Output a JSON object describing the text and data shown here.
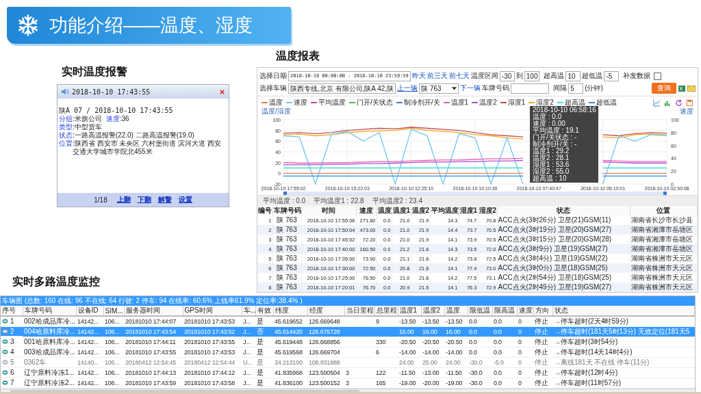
{
  "banner": {
    "title": "功能介绍——温度、湿度"
  },
  "alarm": {
    "heading": "实时温度报警",
    "time": "2018-10-10 17:43:55",
    "first_line": "陕A 07 / 2018-10-10 17:43:55",
    "lines": [
      [
        {
          "label": "分组",
          "value": ":米旗公司"
        },
        {
          "label": "速度",
          "value": ":36"
        }
      ],
      [
        {
          "label": "类型",
          "value": ":中型货车"
        }
      ],
      [
        {
          "label": "状态",
          "value": ":一路高温报警(22.0) 二路高温报警(19.0)"
        }
      ],
      [
        {
          "label": "位置",
          "value": ":陕西省 西安市 未央区 六村堡街道 滨河大道 西安交通大学城市学院北455米"
        }
      ]
    ],
    "page": "1/18",
    "links": [
      "上翻",
      "下翻",
      "解警",
      "设置"
    ]
  },
  "report": {
    "heading": "温度报表",
    "date_label": "选择日期",
    "date_value": "2018-10-10 00:00:00 - 2018-10-10 23:59:59",
    "quick_links": [
      "昨天",
      "前三天",
      "前七天"
    ],
    "range_label": "温度区间",
    "range_from": "-30",
    "range_to_label": "到",
    "range_to": "100",
    "high_label": "超高温",
    "high_value": "10",
    "low_label": "超低温",
    "low_value": "-5",
    "resend_label": "补发数据",
    "resend_checked": false,
    "vehicle_label": "选择车辆",
    "vehicle_value": "陕西专线,北京 有限公司,陕A 42,陕",
    "prev_link": "上一辆",
    "vehicle_select": "陕 763",
    "next_link": "下一辆",
    "plate_label": "车牌号码",
    "interval_label": "间隔",
    "interval_value": "5",
    "interval_unit": "(分钟)",
    "query_button": "查询",
    "legend": [
      {
        "label": "温度",
        "color": "#f08050"
      },
      {
        "label": "速度",
        "color": "#6ec6f0"
      },
      {
        "label": "平均温度",
        "color": "#c848c8"
      },
      {
        "label": "门开/关状态",
        "color": "#2ecc40"
      },
      {
        "label": "制冷剂开/关",
        "color": "#3a7bd5"
      },
      {
        "label": "温度1",
        "color": "#e85fb0"
      },
      {
        "label": "温度2",
        "color": "#b04fd6"
      },
      {
        "label": "湿度1",
        "color": "#c0504d"
      },
      {
        "label": "湿度2",
        "color": "#f5a623"
      },
      {
        "label": "超高温",
        "color": "#40e0d0"
      },
      {
        "label": "超低温",
        "color": "#1e90ff"
      }
    ],
    "left_axis_title": "温度/湿度",
    "right_axis_title": "速度",
    "chart_data": {
      "type": "line",
      "categories": [
        "2018-10-10 17:55:02",
        null,
        null,
        null,
        "2018-10-10 15:22:03",
        null,
        null,
        null,
        "2018-10-10 12:25:10",
        null,
        null,
        null,
        "2018-10-10 10:10:30",
        null,
        null,
        null,
        "2018-10-10 07:40:47",
        null,
        null,
        null,
        "2018-10-10 05:10:01",
        null,
        null,
        null,
        "2018-10-10 02:30:08"
      ],
      "grid": true,
      "yticks": [
        100,
        80,
        60,
        40,
        20,
        0,
        -20
      ],
      "ylim": [
        -20,
        100
      ],
      "y2ticks": [
        100,
        80,
        60,
        40,
        20,
        0
      ],
      "y2lim": [
        0,
        100
      ],
      "series": [
        {
          "color": "#c0504d",
          "values": [
            75,
            76,
            74,
            76,
            80,
            82,
            84,
            83,
            86,
            84,
            82,
            80,
            76,
            72,
            70,
            68,
            null,
            null,
            null,
            null,
            72,
            70,
            74,
            76,
            75
          ]
        },
        {
          "color": "#f5a623",
          "values": [
            72,
            73,
            70,
            72,
            76,
            78,
            79,
            80,
            84,
            80,
            78,
            76,
            72,
            70,
            66,
            64,
            null,
            null,
            null,
            null,
            68,
            66,
            72,
            73,
            72
          ]
        },
        {
          "color": "#6ec6f0",
          "values": [
            70,
            68,
            -20,
            72,
            78,
            60,
            76,
            -20,
            82,
            70,
            -20,
            74,
            66,
            -20,
            66,
            -20,
            null,
            null,
            null,
            null,
            -20,
            70,
            60,
            72,
            70
          ]
        },
        {
          "color": "#e85fb0",
          "values": [
            20,
            19,
            19,
            20,
            20,
            21,
            22,
            22,
            23,
            24,
            25,
            25,
            26,
            27,
            27,
            28,
            null,
            null,
            null,
            null,
            24,
            23,
            22,
            22,
            22
          ]
        },
        {
          "color": "#b04fd6",
          "values": [
            16,
            16,
            16,
            17,
            17,
            18,
            18,
            19,
            20,
            21,
            21,
            22,
            22,
            23,
            23,
            24,
            null,
            null,
            null,
            null,
            21,
            20,
            19,
            19,
            19
          ]
        },
        {
          "color": "#40e0d0",
          "values": [
            10,
            10,
            10,
            10,
            10,
            10,
            10,
            10,
            10,
            10,
            10,
            10,
            10,
            10,
            10,
            10,
            null,
            null,
            null,
            null,
            10,
            10,
            10,
            10,
            10
          ]
        },
        {
          "color": "#f08050",
          "values": [
            0,
            0,
            0,
            0,
            0,
            0,
            0,
            0,
            0,
            0,
            0,
            0,
            0,
            0,
            0,
            0,
            null,
            null,
            null,
            null,
            0,
            0,
            0,
            0,
            0
          ]
        },
        {
          "color": "#1e90ff",
          "values": [
            -5,
            -5,
            -5,
            -5,
            -5,
            -5,
            -5,
            -5,
            -5,
            -5,
            -5,
            -5,
            -5,
            -5,
            -5,
            -5,
            null,
            null,
            null,
            null,
            -5,
            -5,
            -5,
            -5,
            -5
          ]
        }
      ]
    },
    "tooltip": [
      "2018-10-10 06:58:16",
      "温度 : 0.0",
      "速度 : 0.00",
      "平均温度 : 19.1",
      "门开/关状态 : -",
      "制冷剂开/关 : -",
      "温度1 : 29.2",
      "温度2 : 28.1",
      "湿度1 : 53.6",
      "湿度2 : 55.0",
      "超高温 : 10"
    ],
    "stats": [
      "平均温度 : 0.0",
      "平均温度1 : 22.8",
      "平均温度2 : 23.4"
    ],
    "columns": [
      "编号",
      "车牌号码",
      "时间",
      "速度",
      "温度",
      "温度1",
      "温度2",
      "平均温度",
      "湿度1",
      "湿度2",
      "状态",
      "位置"
    ],
    "rows": [
      [
        "1",
        "陕 763",
        "2018-10-10 17:55:06",
        "271.80",
        "0.0",
        "21.0",
        "21.9",
        "14.3",
        "74.7",
        "70.8",
        "ACC点火(3时26分) 卫星(21)GSM(11)",
        "湖南省长沙市长沙县"
      ],
      [
        "2",
        "陕 763",
        "2018-10-10 17:50:04",
        "473.00",
        "0.0",
        "21.0",
        "21.9",
        "14.4",
        "73.7",
        "70.5",
        "ACC点火(3时19分) 卫星(20)GSM(27)",
        "湖南省湘潭市岳塘区"
      ],
      [
        "3",
        "陕 763",
        "2018-10-10 17:45:02",
        "72.20",
        "0.0",
        "21.0",
        "21.9",
        "14.1",
        "73.9",
        "70.5",
        "ACC点火(3时15分) 卫星(20)GSM(28)",
        "湖南省湘潭市岳塘区"
      ],
      [
        "4",
        "陕 763",
        "2018-10-10 17:40:00",
        "160.50",
        "0.0",
        "21.2",
        "21.6",
        "14.3",
        "73.5",
        "72.0",
        "ACC点火(3时9分) 卫星(19)GSM(27)",
        "湖南省湘潭市岳塘区"
      ],
      [
        "5",
        "陕 763",
        "2018-10-10 17:35:00",
        "73.90",
        "0.0",
        "21.1",
        "21.6",
        "14.2",
        "73.8",
        "72.5",
        "ACC点火(3时4分) 卫星(19)GSM(22)",
        "湖南省株洲市天元区"
      ],
      [
        "6",
        "陕 763",
        "2018-10-10 17:30:00",
        "72.50",
        "0.0",
        "20.8",
        "21.6",
        "14.1",
        "77.4",
        "73.0",
        "ACC点火(3时0分) 卫星(18)GSM(25)",
        "湖南省株洲市天元区"
      ],
      [
        "7",
        "陕 763",
        "2018-10-10 17:25:00",
        "76.50",
        "0.0",
        "21.0",
        "21.6",
        "14.2",
        "77.5",
        "73.1",
        "ACC点火(2时54分) 卫星(18)GSM(25)",
        "湖南省株洲市天元区"
      ],
      [
        "8",
        "陕 763",
        "2018-10-10 17:20:01",
        "76.70",
        "0.0",
        "20.9",
        "21.5",
        "14.1",
        "76.3",
        "72.9",
        "ACC点火(2时49分) 卫星(19)GSM(27)",
        "湖南省株洲市天元区"
      ]
    ]
  },
  "monitor": {
    "heading": "实时多路温度监控",
    "status_bar": "车辆图  (总数: 160 在线: 96 不在线: 64 行驶: 2 停车: 94 在线率: 60.6% 上线率61.9% 定位率:38.4% )",
    "columns": [
      "序号",
      "车牌号码",
      "设备ID",
      "SIM...",
      "服务器时间",
      "GPS时间",
      "车...",
      "有效",
      "纬度",
      "经度",
      "当日里程",
      "总里程",
      "温度1",
      "温度2",
      "温度",
      "限低温",
      "限高温",
      "速度",
      "方向",
      "状态"
    ],
    "rows": [
      {
        "online": true,
        "selected": false,
        "cells": [
          "1",
          "002哈成品库冷...",
          "14142...",
          "106...",
          "20181010 17:44:07",
          "20181010 17:43:53",
          "J...",
          "是",
          "45.619652",
          "126.669648",
          null,
          "9",
          "-13.50",
          "-13.50",
          "-13.50",
          "0.0",
          "0.0",
          "0",
          "停止",
          "→停车超时(2天4时59分)"
        ]
      },
      {
        "online": true,
        "selected": true,
        "cells": [
          "2",
          "004哈原料库冷...",
          "14142...",
          "106...",
          "20181010 17:43:54",
          "20181010 17:43:52",
          "J...",
          "否",
          "45.614420",
          "126.675728",
          null,
          null,
          "16.00",
          "16.00",
          "16.00",
          "0.0",
          "0.0",
          "0",
          "停止",
          "→停车超时(181天5时13分)  无效定位(181天5"
        ]
      },
      {
        "online": true,
        "selected": false,
        "cells": [
          "3",
          "001哈原料库冷...",
          "14142...",
          "106...",
          "20181010 17:44:11",
          "20181010 17:43:55",
          "J...",
          "是",
          "45.619448",
          "126.668856",
          null,
          "330",
          "-20.50",
          "-20.50",
          "-20.50",
          "0.0",
          "0.0",
          "0",
          "停止",
          "→停车超时(3时54分)"
        ]
      },
      {
        "online": true,
        "selected": false,
        "cells": [
          "4",
          "003哈成品库冷...",
          "14142...",
          "106...",
          "20181010 17:43:55",
          "20181010 17:43:53",
          "J...",
          "是",
          "45.619568",
          "126.669704",
          null,
          "6",
          "-14.00",
          "-14.00",
          "-14.00",
          "0.0",
          "0.0",
          "0",
          "停止",
          "→停车超时(14天14时4分)"
        ]
      },
      {
        "online": false,
        "selected": false,
        "cells": [
          "5",
          "0362车",
          "14140...",
          "106...",
          "20180412 12:54:45",
          "20180412 12:54:44",
          "U...",
          "是",
          "34.213100",
          "108.931888",
          null,
          null,
          "24.00",
          "25.00",
          "24.00",
          "-30.0",
          "-5.0",
          "0",
          "停止",
          "→离线181天 不在线 停车(11分)"
        ]
      },
      {
        "online": true,
        "selected": false,
        "cells": [
          "6",
          "辽宁原料冷冻1...",
          "14142...",
          "106...",
          "20181010 17:44:13",
          "20181010 17:44:12",
          "J...",
          "是",
          "41.835968",
          "123.500504",
          "3",
          "122",
          "-11.50",
          "-13.00",
          "-11.50",
          "-30.0",
          "0.0",
          "0",
          "停止",
          "→停车超时(12时4分)"
        ]
      },
      {
        "online": true,
        "selected": false,
        "cells": [
          "7",
          "辽宁原料冷冻2...",
          "14142...",
          "106...",
          "20181010 17:43:59",
          "20181010 17:43:58",
          "J...",
          "是",
          "41.836100",
          "123.500152",
          "3",
          "165",
          "-19.00",
          "-20.00",
          "-19.00",
          "-30.0",
          "0.0",
          "0",
          "停止",
          "→停车超时(11时57分)"
        ]
      }
    ]
  }
}
